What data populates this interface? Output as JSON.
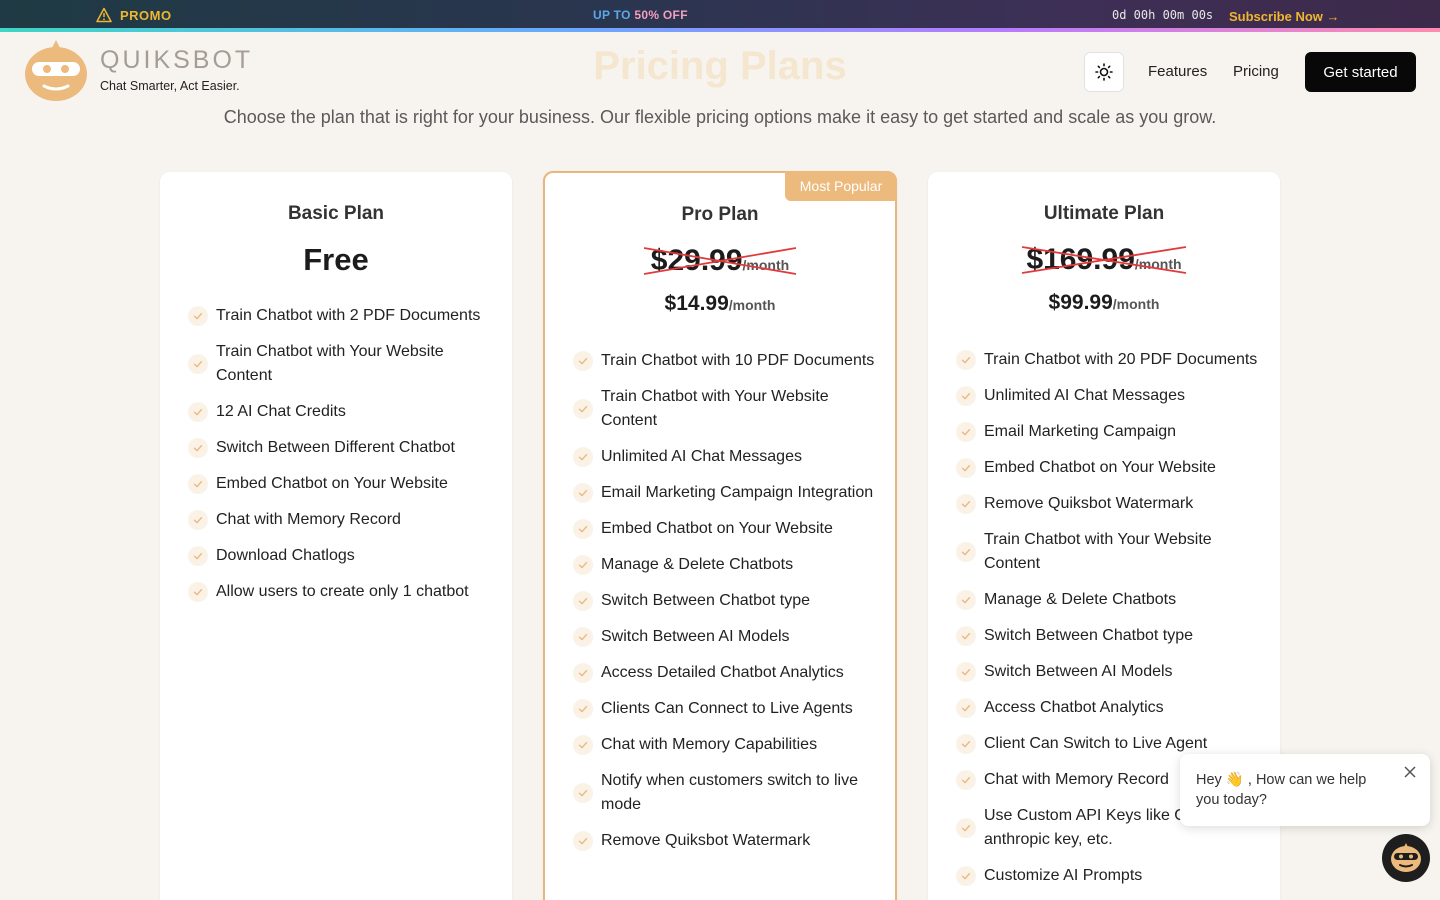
{
  "promo": {
    "label": "PROMO",
    "offer_prefix": "UP TO ",
    "offer_highlight": "50% OFF",
    "timer": "0d 00h 00m 00s",
    "subscribe": "Subscribe Now →"
  },
  "brand": {
    "name": "QUIKSBOT",
    "tagline": "Chat Smarter, Act Easier."
  },
  "page": {
    "title": "Pricing Plans",
    "subtitle": "Choose the plan that is right for your business. Our flexible pricing options make it easy to get started and scale as you grow."
  },
  "nav": {
    "features": "Features",
    "pricing": "Pricing",
    "get_started": "Get started"
  },
  "plans": {
    "basic": {
      "name": "Basic Plan",
      "price": "Free",
      "features": [
        "Train Chatbot with 2 PDF Documents",
        "Train Chatbot with Your Website Content",
        "12 AI Chat Credits",
        "Switch Between Different Chatbot",
        "Embed Chatbot on Your Website",
        "Chat with Memory Record",
        "Download Chatlogs",
        "Allow users to create only 1 chatbot"
      ]
    },
    "pro": {
      "badge": "Most Popular",
      "name": "Pro Plan",
      "old_price": "$29.99",
      "per": "/month",
      "new_price": "$14.99",
      "features": [
        "Train Chatbot with 10 PDF Documents",
        "Train Chatbot with Your Website Content",
        "Unlimited AI Chat Messages",
        "Email Marketing Campaign Integration",
        "Embed Chatbot on Your Website",
        "Manage & Delete Chatbots",
        "Switch Between Chatbot type",
        "Switch Between AI Models",
        "Access Detailed Chatbot Analytics",
        "Clients Can Connect to Live Agents",
        "Chat with Memory Capabilities",
        "Notify when customers switch to live mode",
        "Remove Quiksbot Watermark"
      ]
    },
    "ultimate": {
      "name": "Ultimate Plan",
      "old_price": "$169.99",
      "per": "/month",
      "new_price": "$99.99",
      "features": [
        "Train Chatbot with 20 PDF Documents",
        "Unlimited AI Chat Messages",
        "Email Marketing Campaign",
        "Embed Chatbot on Your Website",
        "Remove Quiksbot Watermark",
        "Train Chatbot with Your Website Content",
        "Manage & Delete Chatbots",
        "Switch Between Chatbot type",
        "Switch Between AI Models",
        "Access Chatbot Analytics",
        "Client Can Switch to Live Agent",
        "Chat with Memory Record",
        "Use Custom API Keys like Openai key, anthropic key, etc.",
        "Customize AI Prompts"
      ]
    }
  },
  "chat": {
    "message": "Hey 👋 , How can we help you today?"
  },
  "colors": {
    "accent": "#ecba7d",
    "promo_yellow": "#f0b62e",
    "strike": "#e23a3a"
  }
}
